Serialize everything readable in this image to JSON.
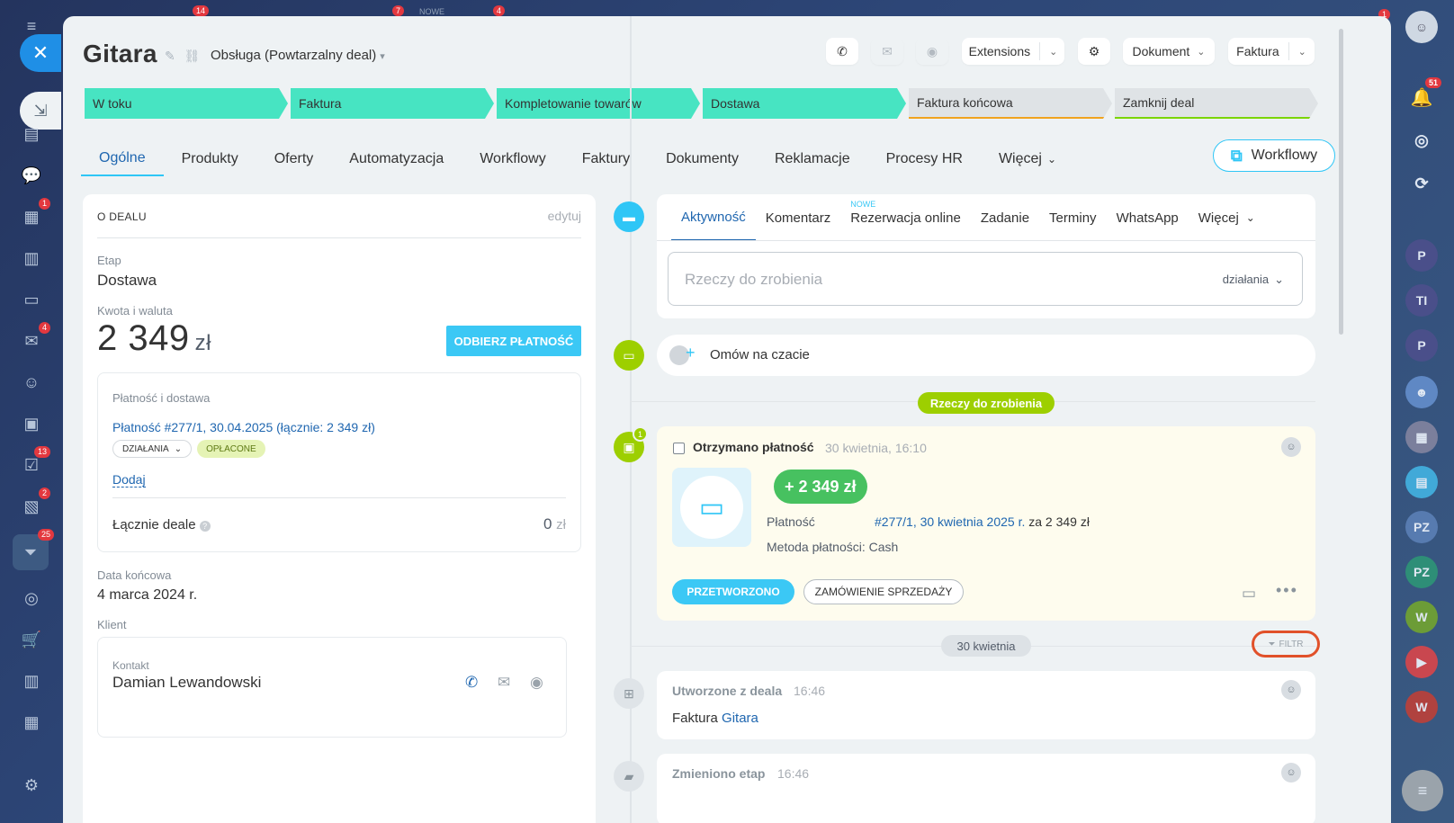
{
  "left_sidebar": {
    "close_icon": "close-icon",
    "badges": [
      "1",
      "4",
      "13",
      "2",
      "25"
    ]
  },
  "top_bg": {
    "badges": [
      "14",
      "7",
      "NOWE",
      "4",
      "1"
    ]
  },
  "right_sidebar": {
    "notif_badge": "51",
    "chats": [
      "P",
      "TI",
      "P",
      "PZ",
      "PZ",
      "W",
      "W"
    ]
  },
  "header": {
    "title": "Gitara",
    "pipeline": "Obsługa (Powtarzalny deal)",
    "extensions_label": "Extensions",
    "dokument_label": "Dokument",
    "faktura_label": "Faktura"
  },
  "stages": [
    {
      "label": "W toku",
      "color": "#47e4c2"
    },
    {
      "label": "Faktura",
      "color": "#47e4c2"
    },
    {
      "label": "Kompletowanie towarów",
      "color": "#47e4c2"
    },
    {
      "label": "Dostawa",
      "color": "#47e4c2"
    },
    {
      "label": "Faktura końcowa",
      "color": "#dfe3e6"
    },
    {
      "label": "Zamknij deal",
      "color": "#dfe3e6"
    }
  ],
  "tabs": [
    "Ogólne",
    "Produkty",
    "Oferty",
    "Automatyzacja",
    "Workflowy",
    "Faktury",
    "Dokumenty",
    "Reklamacje",
    "Procesy HR",
    "Więcej"
  ],
  "workflow_button": "Workflowy",
  "deal": {
    "section_title": "O DEALU",
    "edit_label": "edytuj",
    "stage_label": "Etap",
    "stage_value": "Dostawa",
    "amount_label": "Kwota i waluta",
    "amount_value": "2 349",
    "amount_currency": "zł",
    "pay_button": "ODBIERZ PŁATNOŚĆ",
    "payment_section_label": "Płatność i dostawa",
    "payment_link": "Płatność #277/1, 30.04.2025 (łącznie: 2 349 zł)",
    "actions_pill": "DZIAŁANIA",
    "paid_pill": "OPŁACONE",
    "add_link": "Dodaj",
    "total_label": "Łącznie deale",
    "total_value": "0",
    "total_currency": "zł",
    "end_date_label": "Data końcowa",
    "end_date_value": "4 marca 2024 r.",
    "client_label": "Klient",
    "contact_label": "Kontakt",
    "contact_name": "Damian Lewandowski"
  },
  "activity": {
    "tabs": [
      "Aktywność",
      "Komentarz",
      "Rezerwacja online",
      "Zadanie",
      "Terminy",
      "WhatsApp",
      "Więcej"
    ],
    "new_badge": "NOWE",
    "todo_placeholder": "Rzeczy do zrobienia",
    "actions_dropdown": "działania",
    "chat_label": "Omów na czacie",
    "todo_chip": "Rzeczy do zrobienia",
    "payment_title": "Otrzymano płatność",
    "payment_time": "30 kwietnia, 16:10",
    "payment_amount": "+ 2 349 zł",
    "payment_label": "Płatność",
    "payment_link": "#277/1, 30 kwietnia 2025 r.",
    "payment_suffix": "za 2 349 zł",
    "payment_method": "Metoda płatności: Cash",
    "processed_button": "PRZETWORZONO",
    "order_button": "ZAMÓWIENIE SPRZEDAŻY",
    "wallet_badge": "1",
    "date_chip": "30 kwietnia",
    "filter_label": "FILTR",
    "created_title": "Utworzone z deala",
    "created_time": "16:46",
    "created_prefix": "Faktura",
    "created_link": "Gitara",
    "changed_title": "Zmieniono etap",
    "changed_time": "16:46"
  }
}
